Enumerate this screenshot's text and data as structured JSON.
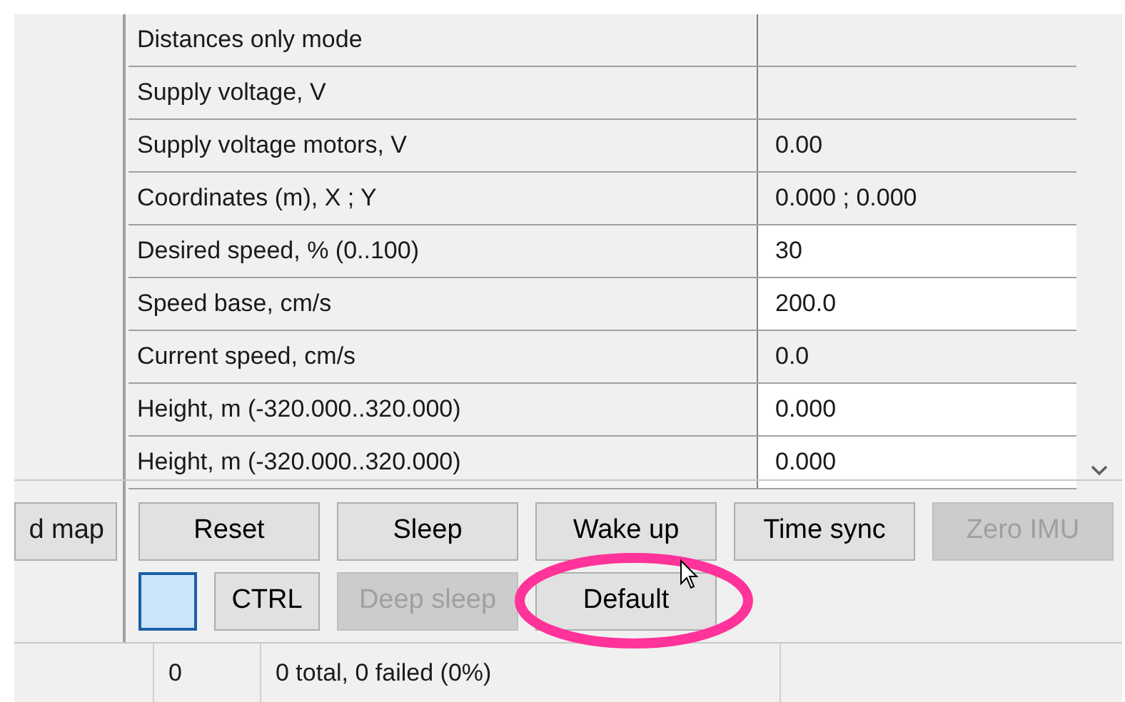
{
  "side_button": {
    "label": "d map"
  },
  "properties": [
    {
      "name": "Distances only mode",
      "editable": false
    },
    {
      "name": "Supply voltage, V",
      "editable": false
    },
    {
      "name": "Supply voltage motors, V",
      "value": "0.00",
      "editable": false
    },
    {
      "name": "Coordinates (m), X ; Y",
      "value": "0.000 ; 0.000",
      "editable": false
    },
    {
      "name": "Desired speed, % (0..100)",
      "value": "30",
      "editable": true
    },
    {
      "name": "Speed base, cm/s",
      "value": "200.0",
      "editable": true
    },
    {
      "name": "Current speed, cm/s",
      "value": "0.0",
      "editable": false
    },
    {
      "name": "Height, m (-320.000..320.000)",
      "value": "0.000",
      "editable": true
    },
    {
      "name": "Height, m (-320.000..320.000)",
      "value": "0.000",
      "editable": true
    }
  ],
  "button_rows": [
    [
      {
        "kind": "button",
        "label": "Reset",
        "disabled": false
      },
      {
        "kind": "button",
        "label": "Sleep",
        "disabled": false
      },
      {
        "kind": "button",
        "label": "Wake up",
        "disabled": false
      },
      {
        "kind": "button",
        "label": "Time sync",
        "disabled": false
      },
      {
        "kind": "button",
        "label": "Zero IMU",
        "disabled": true
      }
    ],
    [
      {
        "kind": "swatch"
      },
      {
        "kind": "compact_button",
        "label": "CTRL",
        "disabled": false
      },
      {
        "kind": "button",
        "label": "Deep sleep",
        "disabled": true
      },
      {
        "kind": "button",
        "label": "Default",
        "disabled": false,
        "highlighted": true
      }
    ]
  ],
  "status_bar": {
    "count": "0",
    "summary": "0 total, 0 failed (0%)"
  }
}
